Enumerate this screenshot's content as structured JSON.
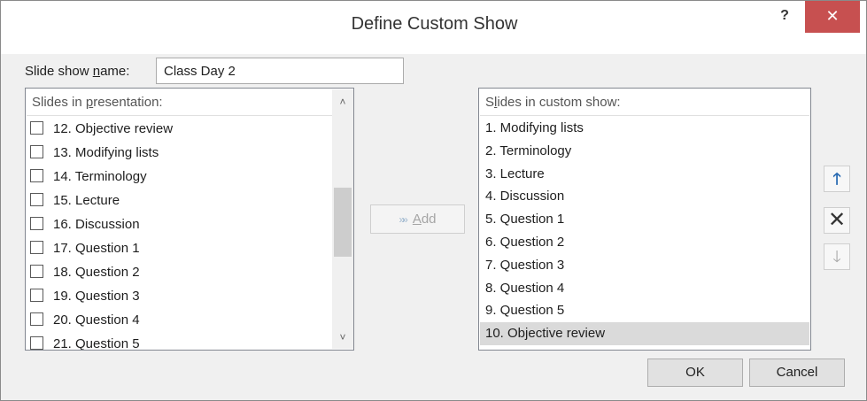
{
  "window": {
    "title": "Define Custom Show",
    "help_glyph": "?",
    "close_glyph": "✕"
  },
  "name_field": {
    "label_prefix": "Slide show ",
    "label_underlined": "n",
    "label_suffix": "ame:",
    "value": "Class Day 2"
  },
  "presentation_list": {
    "header_prefix": "Slides in ",
    "header_underlined": "p",
    "header_suffix": "resentation:",
    "items": [
      {
        "label": "12. Objective review",
        "checked": false
      },
      {
        "label": "13. Modifying lists",
        "checked": false
      },
      {
        "label": "14. Terminology",
        "checked": false
      },
      {
        "label": "15. Lecture",
        "checked": false
      },
      {
        "label": "16. Discussion",
        "checked": false
      },
      {
        "label": "17. Question 1",
        "checked": false
      },
      {
        "label": "18. Question 2",
        "checked": false
      },
      {
        "label": "19. Question 3",
        "checked": false
      },
      {
        "label": "20. Question 4",
        "checked": false
      },
      {
        "label": "21. Question 5",
        "checked": false
      }
    ]
  },
  "add_button": {
    "arrows": "»»",
    "label_underlined": "A",
    "label_rest": "dd",
    "enabled": false
  },
  "custom_list": {
    "header_prefix": "S",
    "header_underlined": "l",
    "header_suffix": "ides in custom show:",
    "items": [
      {
        "label": "1. Modifying lists"
      },
      {
        "label": "2. Terminology"
      },
      {
        "label": "3. Lecture"
      },
      {
        "label": "4. Discussion"
      },
      {
        "label": "5. Question 1"
      },
      {
        "label": "6. Question 2"
      },
      {
        "label": "7. Question 3"
      },
      {
        "label": "8. Question 4"
      },
      {
        "label": "9. Question 5"
      },
      {
        "label": "10. Objective review"
      }
    ],
    "selected_index": 9
  },
  "side_buttons": {
    "move_up_glyph": "🡑",
    "remove_glyph": "✕",
    "move_down_glyph": "🡓"
  },
  "footer": {
    "ok_label": "OK",
    "cancel_label": "Cancel"
  },
  "colors": {
    "close_bg": "#c75050",
    "selection_bg": "#dadada",
    "up_arrow": "#2b6cb3"
  }
}
